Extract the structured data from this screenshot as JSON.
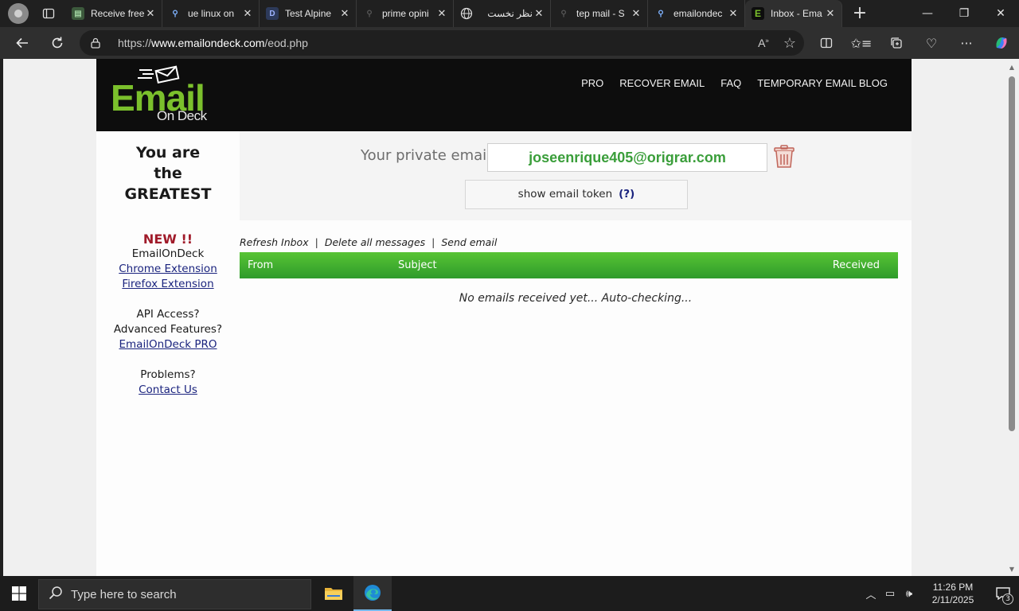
{
  "browser": {
    "tabs": [
      {
        "title": "Receive free",
        "favicon": "doc-icon",
        "active": false
      },
      {
        "title": "ue linux on",
        "favicon": "search-icon",
        "active": false
      },
      {
        "title": "Test Alpine",
        "favicon": "d-icon",
        "active": false
      },
      {
        "title": "prime opini",
        "favicon": "search-icon",
        "active": false
      },
      {
        "title": "نظر نخست",
        "favicon": "globe-icon",
        "active": false
      },
      {
        "title": "tep mail - S",
        "favicon": "search-icon",
        "active": false
      },
      {
        "title": "emailondec",
        "favicon": "search-icon",
        "active": false
      },
      {
        "title": "Inbox - Ema",
        "favicon": "e-icon",
        "active": true
      }
    ],
    "new_tab_label": "+",
    "address": {
      "prefix": "https://",
      "host": "www.emailondeck.com",
      "path": "/eod.php"
    }
  },
  "site": {
    "logo": {
      "main": "Email",
      "sub": "On Deck"
    },
    "nav": [
      "PRO",
      "RECOVER EMAIL",
      "FAQ",
      "TEMPORARY EMAIL BLOG"
    ],
    "sidebar": {
      "slogan": [
        "You are",
        "the",
        "GREATEST"
      ],
      "new_tag": "NEW !!",
      "brand": "EmailOnDeck",
      "chrome_ext": "Chrome Extension",
      "firefox_ext": "Firefox Extension",
      "api_q": "API Access?",
      "adv_q": "Advanced Features?",
      "pro_link": "EmailOnDeck PRO",
      "problems": "Problems?",
      "contact": "Contact Us"
    },
    "email": {
      "label": "Your private email",
      "address": "joseenrique405@origrar.com",
      "token_button": "show email token",
      "token_help": "(?)"
    },
    "actions": {
      "refresh": "Refresh Inbox",
      "delete_all": "Delete all messages",
      "send": "Send email",
      "separator": "|"
    },
    "inbox": {
      "columns": {
        "from": "From",
        "subject": "Subject",
        "received": "Received"
      },
      "empty_message": "No emails received yet... Auto-checking..."
    }
  },
  "taskbar": {
    "search_placeholder": "Type here to search",
    "time": "11:26 PM",
    "date": "2/11/2025",
    "notification_count": "3"
  },
  "colors": {
    "brand_green": "#7bc02c",
    "header_black": "#0d0d0d",
    "email_green": "#3a9e3a",
    "new_red": "#a01b2a",
    "link_blue": "#1a237e"
  }
}
